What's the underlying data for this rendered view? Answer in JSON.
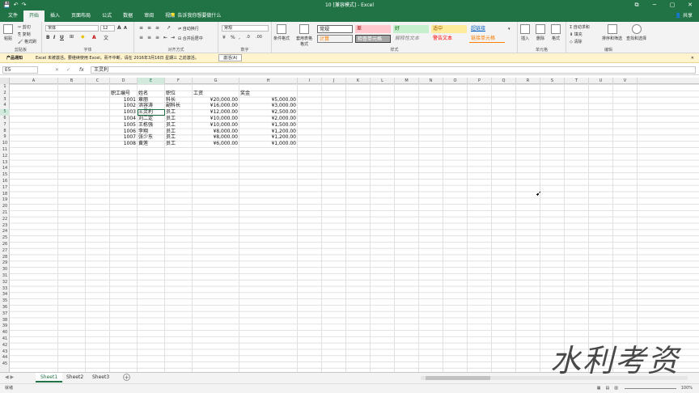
{
  "titlebar": {
    "title": "10 [兼容模式] - Excel",
    "save": "💾",
    "undo": "↶",
    "redo": "↷",
    "min": "─",
    "max": "▢",
    "close": "✕",
    "restore": "⧉"
  },
  "tabs": [
    "文件",
    "开始",
    "插入",
    "页面布局",
    "公式",
    "数据",
    "审阅",
    "视图"
  ],
  "tell_me": "告诉我你想要做什么",
  "share": "共享",
  "ribbon": {
    "clipboard": {
      "paste": "粘贴",
      "cut": "剪切",
      "copy": "复制",
      "format_painter": "格式刷",
      "label": "剪贴板"
    },
    "font": {
      "name": "宋体",
      "size": "12",
      "bold": "B",
      "italic": "I",
      "underline": "U",
      "label": "字体"
    },
    "alignment": {
      "wrap": "自动换行",
      "merge": "合并后居中",
      "label": "对齐方式"
    },
    "number": {
      "format": "常规",
      "label": "数字"
    },
    "styles": {
      "conditional": "条件格式",
      "table_format": "套用表格格式",
      "cells": [
        "常规",
        "差",
        "好",
        "适中",
        "超链接",
        "计算",
        "检查单元格",
        "解释性文本",
        "警告文本",
        "链接单元格"
      ],
      "label": "样式"
    },
    "cells_group": {
      "insert": "插入",
      "delete": "删除",
      "format": "格式",
      "label": "单元格"
    },
    "editing": {
      "autosum": "自动求和",
      "fill": "填充",
      "clear": "清除",
      "sort": "排序和筛选",
      "find": "查找和选择",
      "label": "编辑"
    }
  },
  "message": {
    "title": "产品通知",
    "text": "Excel 未被激活。要继续使用 Excel，而不中断，请在 2016年3月16日 星期三 之前激活。",
    "button": "激活(A)",
    "close": "✕"
  },
  "formula_bar": {
    "namebox": "E5",
    "cancel": "✕",
    "enter": "✓",
    "fx": "fx",
    "value": "王灵利"
  },
  "columns": [
    "A",
    "B",
    "C",
    "D",
    "E",
    "F",
    "G",
    "H",
    "I",
    "J",
    "K",
    "L",
    "M",
    "N",
    "O",
    "P",
    "Q",
    "R",
    "S",
    "T",
    "U",
    "V"
  ],
  "rows": [
    "1",
    "2",
    "3",
    "4",
    "5",
    "6",
    "7",
    "8",
    "9",
    "10",
    "11",
    "12",
    "13",
    "14",
    "15",
    "16",
    "17",
    "18",
    "19",
    "20",
    "21",
    "22",
    "23",
    "24",
    "25",
    "26",
    "27",
    "28",
    "29",
    "30",
    "31",
    "32",
    "33",
    "34",
    "35",
    "36",
    "37",
    "38",
    "39",
    "40",
    "41",
    "42",
    "43",
    "44",
    "45"
  ],
  "table": {
    "headers": {
      "id": "职工编号",
      "name": "姓名",
      "position": "职位",
      "salary": "工资",
      "bonus": "奖金"
    },
    "rows": [
      {
        "id": "1001",
        "name": "章丽",
        "position": "科长",
        "salary": "¥20,000.00",
        "bonus": "¥5,000.00"
      },
      {
        "id": "1002",
        "name": "洪容涛",
        "position": "副科长",
        "salary": "¥16,000.00",
        "bonus": "¥3,000.00"
      },
      {
        "id": "1003",
        "name": "王灵利",
        "position": "员工",
        "salary": "¥12,000.00",
        "bonus": "¥2,500.00"
      },
      {
        "id": "1004",
        "name": "刘二定",
        "position": "员工",
        "salary": "¥10,000.00",
        "bonus": "¥2,000.00"
      },
      {
        "id": "1005",
        "name": "王栋强",
        "position": "员工",
        "salary": "¥10,000.00",
        "bonus": "¥1,500.00"
      },
      {
        "id": "1006",
        "name": "李翔",
        "position": "员工",
        "salary": "¥8,000.00",
        "bonus": "¥1,200.00"
      },
      {
        "id": "1007",
        "name": "张少东",
        "position": "员工",
        "salary": "¥8,000.00",
        "bonus": "¥1,200.00"
      },
      {
        "id": "1008",
        "name": "黄莲",
        "position": "员工",
        "salary": "¥6,000.00",
        "bonus": "¥1,000.00"
      }
    ]
  },
  "sheets": [
    "Sheet1",
    "Sheet2",
    "Sheet3"
  ],
  "status": {
    "ready": "就绪",
    "zoom": "100%"
  },
  "watermark": "水利考资",
  "colors": {
    "accent": "#217346",
    "bad": "#ffc7ce",
    "good": "#c6efce",
    "neutral": "#ffeb9c"
  }
}
